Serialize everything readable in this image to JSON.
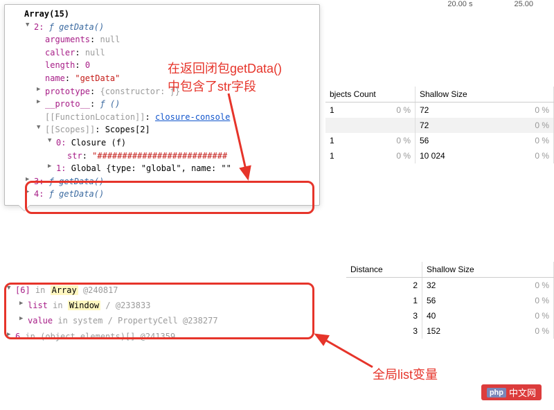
{
  "timeline": {
    "t1": "20.00 s",
    "t2": "25.00"
  },
  "console": {
    "title": "Array(15)",
    "item2": {
      "key": "2:",
      "fn": "ƒ",
      "name": "getData()"
    },
    "props": {
      "arguments_k": "arguments",
      "arguments_v": "null",
      "caller_k": "caller",
      "caller_v": "null",
      "length_k": "length",
      "length_v": "0",
      "name_k": "name",
      "name_v": "\"getData\"",
      "prototype_k": "prototype",
      "prototype_v": "{constructor: ƒ}",
      "proto_k": "__proto__",
      "proto_v": "ƒ ()",
      "funloc_k": "[[FunctionLocation]]",
      "funloc_v": "closure-console",
      "scopes_k": "[[Scopes]]",
      "scopes_v": "Scopes[2]",
      "closure_k": "0:",
      "closure_v": "Closure (f)",
      "str_k": "str",
      "str_v": "\"##########################",
      "global_k": "1:",
      "global_v": "Global {type: \"global\", name: \"\""
    },
    "item3": {
      "key": "3:",
      "fn": "ƒ",
      "name": "getData()"
    },
    "item4": {
      "key": "4:",
      "fn": "ƒ",
      "name": "getData()"
    }
  },
  "annotation1_l1": "在返回闭包getData()",
  "annotation1_l2": "中包含了str字段",
  "annotation2": "全局list变量",
  "table1": {
    "h_count": "bjects Count",
    "h_shallow": "Shallow Size",
    "rows": [
      {
        "count": "1",
        "cpct": "0 %",
        "shallow": "72",
        "spct": "0 %"
      },
      {
        "count": "",
        "cpct": "",
        "shallow": "72",
        "spct": "0 %"
      },
      {
        "count": "1",
        "cpct": "0 %",
        "shallow": "56",
        "spct": "0 %"
      },
      {
        "count": "1",
        "cpct": "0 %",
        "shallow": "10 024",
        "spct": "0 %"
      }
    ]
  },
  "table2": {
    "h_dist": "Distance",
    "h_shallow": "Shallow Size",
    "rows": [
      {
        "dist": "2",
        "shallow": "32",
        "pct": "0 %"
      },
      {
        "dist": "1",
        "shallow": "56",
        "pct": "0 %"
      },
      {
        "dist": "3",
        "shallow": "40",
        "pct": "0 %"
      },
      {
        "dist": "3",
        "shallow": "152",
        "pct": "0 %"
      }
    ]
  },
  "retainers": {
    "r0_key": "[6]",
    "r0_in": " in ",
    "r0_obj": "Array",
    "r0_at": " @240817",
    "r1_key": "list",
    "r1_in": " in ",
    "r1_obj": "Window",
    "r1_sep": " / ",
    "r1_at": "@233833",
    "r2_key": "value",
    "r2_in": " in system / PropertyCell ",
    "r2_at": "@238277",
    "r3_key": "6",
    "r3_in": " in (object elements)[] ",
    "r3_at": "@241359"
  },
  "watermark": {
    "php": "php",
    "cn": "中文网"
  }
}
